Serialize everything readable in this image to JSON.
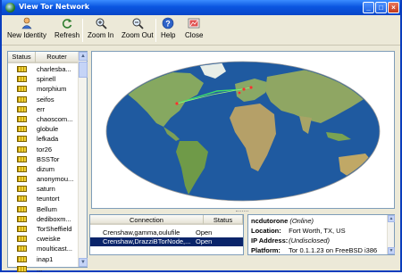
{
  "window": {
    "title": "View Tor Network",
    "controls": [
      "_",
      "□",
      "×"
    ]
  },
  "toolbar": {
    "new_identity": "New Identity",
    "refresh": "Refresh",
    "zoom_in": "Zoom In",
    "zoom_out": "Zoom Out",
    "help": "Help",
    "close": "Close"
  },
  "router_list": {
    "headers": {
      "status": "Status",
      "router": "Router"
    },
    "routers": [
      "charlesba...",
      "spinell",
      "morphium",
      "seifos",
      "err",
      "chaoscom...",
      "globule",
      "lefkada",
      "tor26",
      "BSSTor",
      "dizum",
      "anonymou...",
      "saturn",
      "teuntort",
      "Bellum",
      "dediboxm...",
      "TorSheffield",
      "cweiske",
      "moulticast...",
      "inap1",
      "..."
    ]
  },
  "connections": {
    "headers": {
      "connection": "Connection",
      "status": "Status"
    },
    "rows": [
      {
        "path": "Crenshaw,gamma,oulufile",
        "status": "Open",
        "selected": false
      },
      {
        "path": "Crenshaw,DrazziBTorNode,...",
        "status": "Open",
        "selected": true
      }
    ]
  },
  "router_info": {
    "name": "ncdutorone",
    "state": "(Online)",
    "location_label": "Location:",
    "location": "Fort Worth, TX, US",
    "ip_label": "IP Address:",
    "ip": "(Undisclosed)",
    "platform_label": "Platform:",
    "platform": "Tor 0.1.1.23 on FreeBSD i386"
  },
  "colors": {
    "titlebar": "#0a55e0",
    "selection": "#0a246a",
    "ocean": "#2c6cb5",
    "land": "#7aa35a"
  }
}
